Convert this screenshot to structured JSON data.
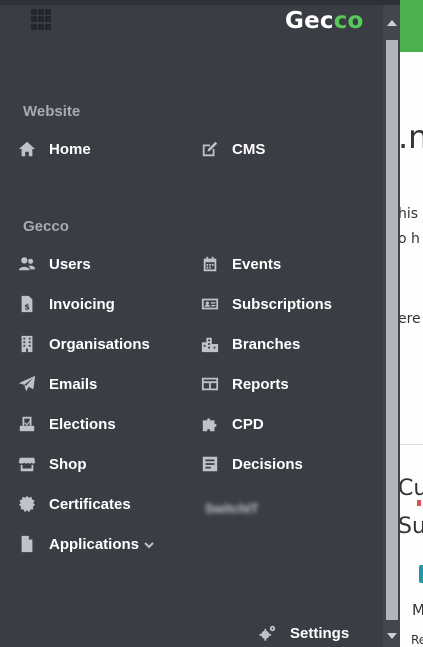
{
  "brand": {
    "logo_main": "Gec",
    "logo_accent": "co"
  },
  "sections": [
    {
      "title": "Website"
    },
    {
      "title": "Gecco"
    }
  ],
  "menu": {
    "home": "Home",
    "cms": "CMS",
    "users": "Users",
    "events": "Events",
    "invoicing": "Invoicing",
    "subscriptions": "Subscriptions",
    "organisations": "Organisations",
    "branches": "Branches",
    "emails": "Emails",
    "reports": "Reports",
    "elections": "Elections",
    "cpd": "CPD",
    "shop": "Shop",
    "decisions": "Decisions",
    "certificates": "Certificates",
    "blurred_item": "SwitchIT",
    "applications": "Applications",
    "settings": "Settings"
  },
  "background_page": {
    "heading_fragment": ".n",
    "line1": "his",
    "line2": "o h",
    "line3": "ere",
    "cur": "Cur",
    "sub": "Sub",
    "m": "M",
    "re": "Re"
  },
  "colors": {
    "drawer_bg": "#3a3d44",
    "accent_green": "#5ac85a",
    "header_green": "#4caf50"
  }
}
